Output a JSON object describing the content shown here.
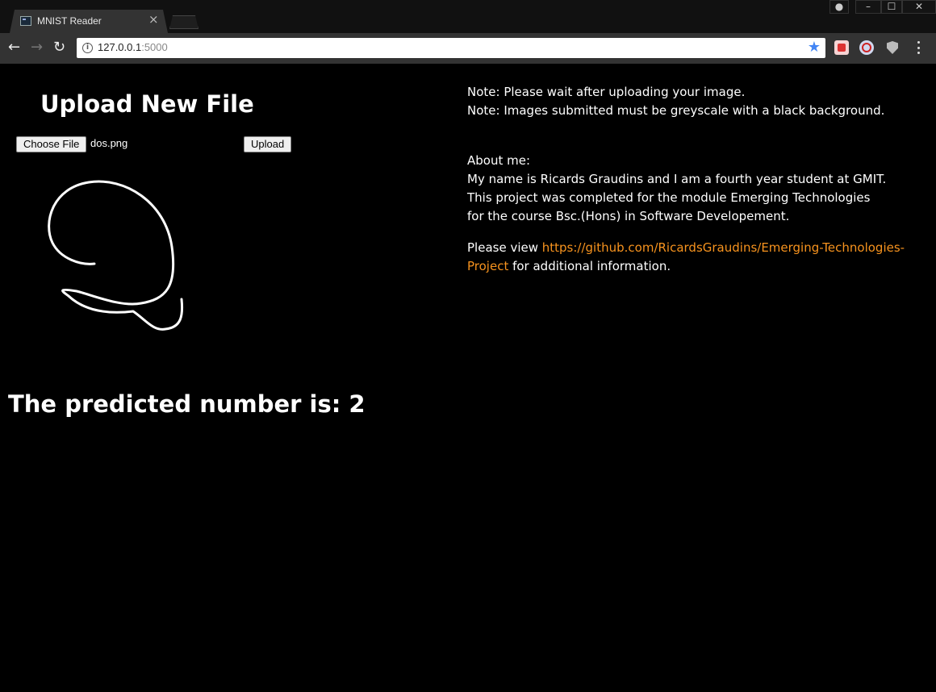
{
  "browser": {
    "tab_title": "MNIST Reader",
    "tab_close": "×",
    "url_host": "127.0.0.1",
    "url_port": ":5000",
    "info_icon": "i",
    "bookmark_icon": "star-icon",
    "back_label": "←",
    "forward_label": "→",
    "reload_label": "↻",
    "bookmark_glyph": "★",
    "window_buttons": {
      "minimize": "–",
      "maximize": "☐",
      "close": "✕"
    }
  },
  "upload": {
    "title": "Upload New File",
    "choose_button": "Choose File",
    "file_name": "dos.png",
    "upload_button": "Upload"
  },
  "result": {
    "prediction_text": "The predicted number is: 2"
  },
  "notes": {
    "line1": "Note: Please wait after uploading your image.",
    "line2": "Note: Images submitted must be greyscale with a black background."
  },
  "about": {
    "heading": "About me:",
    "line1": "My name is Ricards Graudins and I am a fourth year student at GMIT.",
    "line2": "This project was completed for the module Emerging Technologies",
    "line3": "for the course Bsc.(Hons) in Software Developement.",
    "view_prefix": "Please view ",
    "link_text": "https://github.com/RicardsGraudins/Emerging-Technologies-Project",
    "view_suffix": " for additional information."
  },
  "colors": {
    "background": "#000000",
    "text": "#ffffff",
    "link": "#f7931e"
  }
}
